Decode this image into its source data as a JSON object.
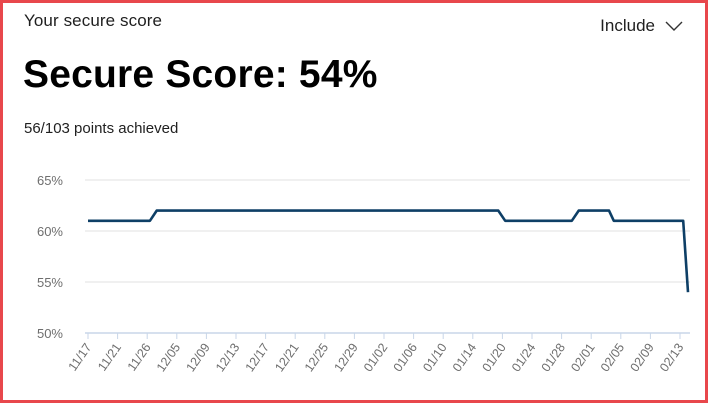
{
  "card": {
    "title": "Your secure score",
    "include_label": "Include",
    "include_icon": "chevron-down-icon",
    "score_label": "Secure Score: 54%",
    "points_text": "56/103 points achieved"
  },
  "colors": {
    "border": "#e8474c",
    "line": "#0e3f66",
    "grid": "#e1e1e1",
    "axis": "#c8d6e8"
  },
  "chart_data": {
    "type": "line",
    "ylim": [
      50,
      65
    ],
    "y_ticks": [
      65,
      60,
      55,
      50
    ],
    "y_tick_labels": [
      "65%",
      "60%",
      "55%",
      "50%"
    ],
    "x_tick_labels": [
      "11/17",
      "11/21",
      "11/26",
      "12/05",
      "12/09",
      "12/13",
      "12/17",
      "12/21",
      "12/25",
      "12/29",
      "01/02",
      "01/06",
      "01/10",
      "01/14",
      "01/20",
      "01/24",
      "01/28",
      "02/01",
      "02/05",
      "02/09",
      "02/13"
    ],
    "series": [
      {
        "x": [
          0,
          9.0,
          10.0,
          59.7,
          60.7,
          70.4,
          71.4,
          75.8,
          76.5,
          79.7,
          81.0,
          86.6,
          87.3
        ],
        "values": [
          61,
          61,
          62,
          62,
          61,
          61,
          62,
          62,
          61,
          61,
          61,
          61,
          54
        ]
      }
    ],
    "grid": true,
    "xlabel": "",
    "ylabel": ""
  }
}
